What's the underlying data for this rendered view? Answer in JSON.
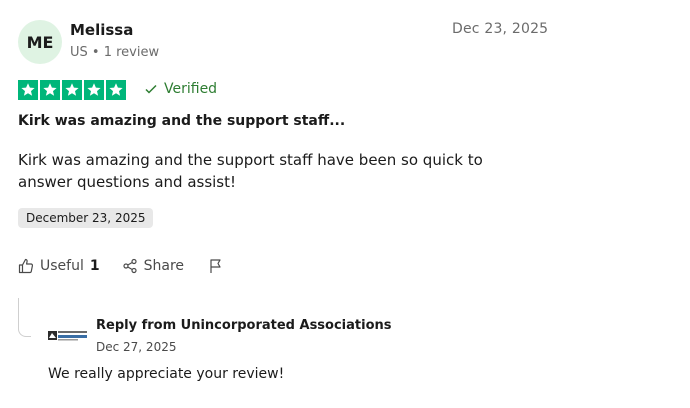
{
  "reviewer": {
    "initials": "ME",
    "name": "Melissa",
    "meta": "US • 1 review"
  },
  "review": {
    "date": "Dec 23, 2025",
    "rating": 5,
    "star_color": "#00b67a",
    "verified_label": "Verified",
    "title": "Kirk was amazing and the support staff...",
    "body": "Kirk was amazing and the support staff have been so quick to answer questions and assist!",
    "experience_date": "December 23, 2025"
  },
  "actions": {
    "useful_label": "Useful",
    "useful_count": "1",
    "share_label": "Share"
  },
  "reply": {
    "title": "Reply from Unincorporated Associations",
    "date": "Dec 27, 2025",
    "body": "We really appreciate your review!",
    "logo_text": "Unincorporated Associations"
  }
}
